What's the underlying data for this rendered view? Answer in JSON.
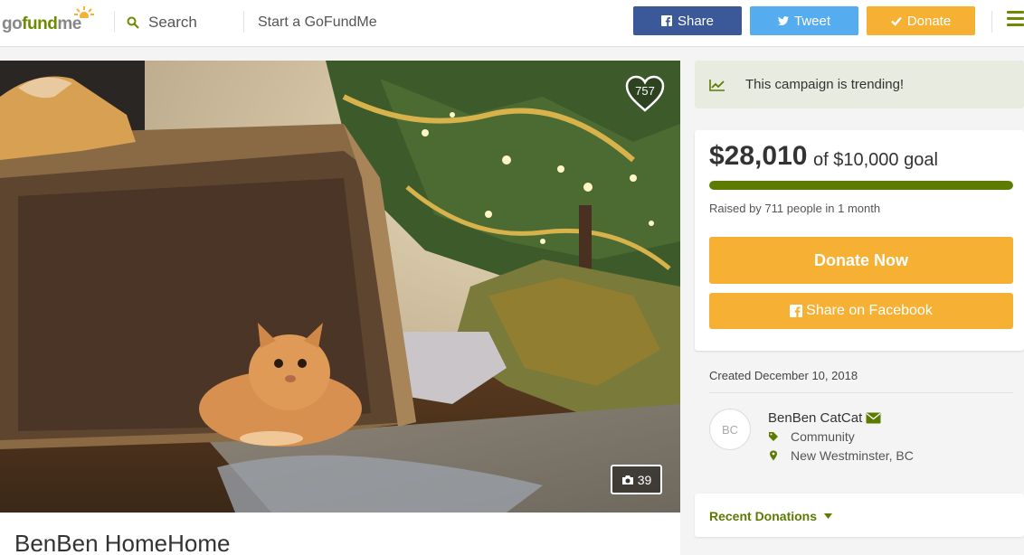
{
  "header": {
    "logo": {
      "go": "go",
      "fund": "fund",
      "me": "me"
    },
    "search_label": "Search",
    "start_label": "Start a GoFundMe",
    "share_label": "Share",
    "tweet_label": "Tweet",
    "donate_label": "Donate"
  },
  "hero": {
    "heart_count": "757",
    "photo_count": "39"
  },
  "campaign": {
    "title": "BenBen HomeHome"
  },
  "sidebar": {
    "trending": "This campaign is trending!",
    "raised": "$28,010",
    "goal": "of $10,000 goal",
    "progress_fraction": 1.0,
    "raised_by": "Raised by 711 people in 1 month",
    "donate_now": "Donate Now",
    "share_facebook": "Share on Facebook",
    "created": "Created December 10, 2018",
    "organizer": {
      "initials": "BC",
      "name": "BenBen CatCat",
      "category": "Community",
      "location": "New Westminster, BC"
    },
    "recent_donations": "Recent Donations"
  },
  "colors": {
    "brand_green": "#5c7b00",
    "donate_orange": "#f6b034",
    "facebook_blue": "#3b5998",
    "twitter_blue": "#55acee"
  },
  "icons": [
    "search-icon",
    "facebook-icon",
    "twitter-icon",
    "check-icon",
    "menu-icon",
    "heart-icon",
    "camera-icon",
    "trending-chart-icon",
    "envelope-icon",
    "tag-icon",
    "map-pin-icon",
    "caret-down-icon"
  ]
}
